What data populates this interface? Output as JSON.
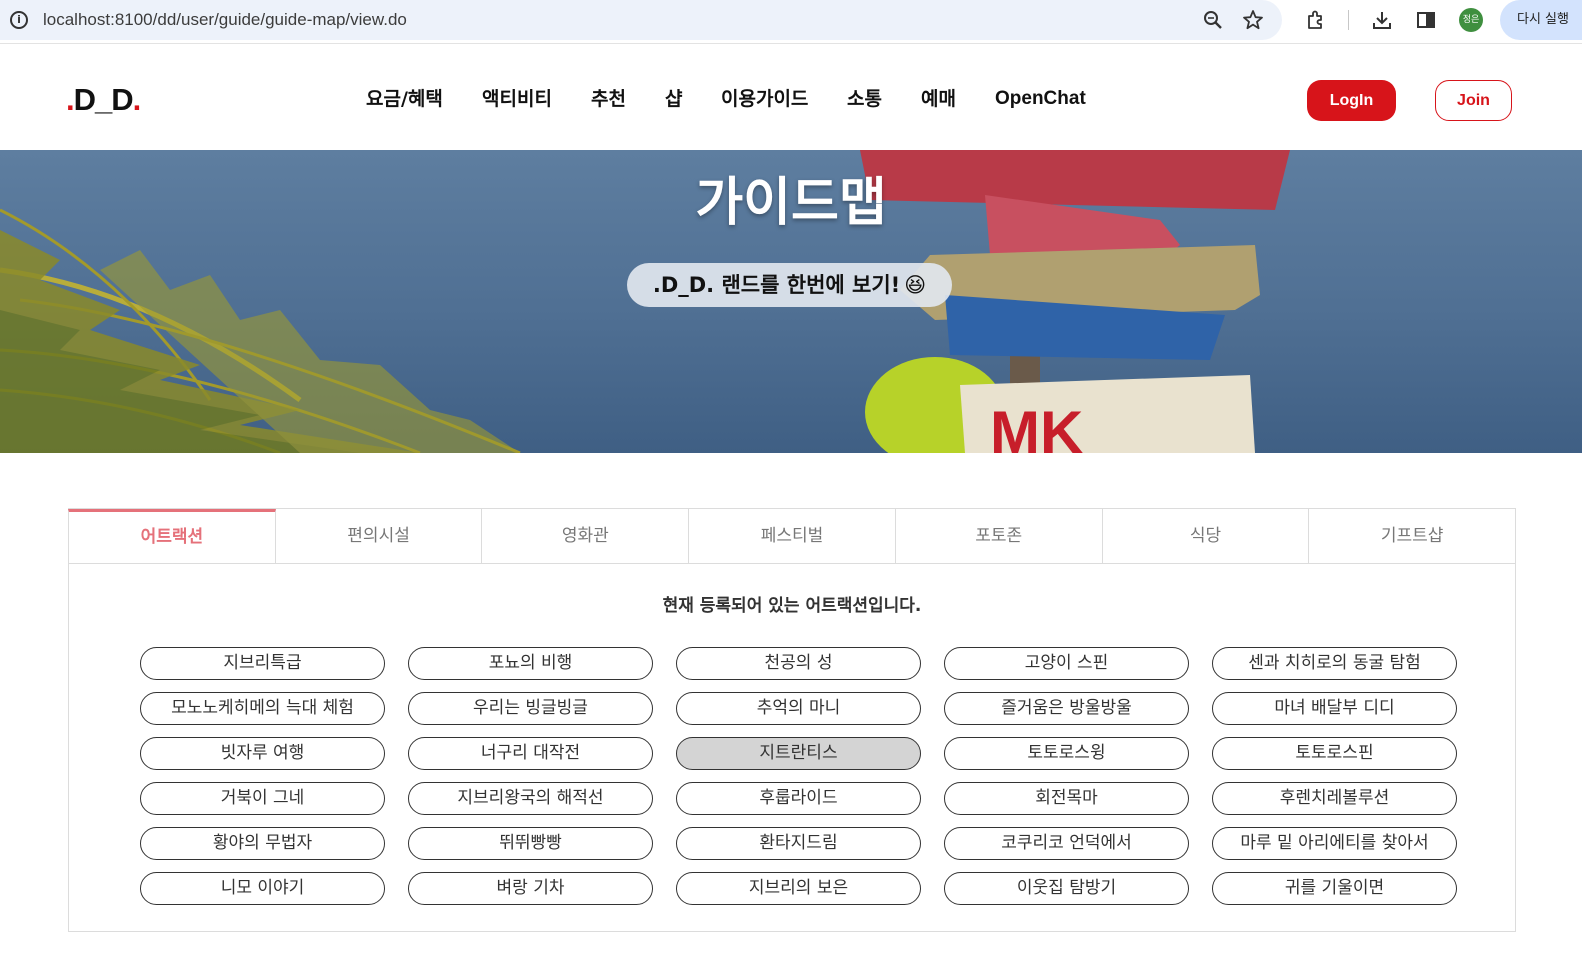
{
  "browser": {
    "url": "localhost:8100/dd/user/guide/guide-map/view.do",
    "profile_label": "정은",
    "relaunch_label": "다시 실행"
  },
  "header": {
    "logo_dot_left": ".",
    "logo_text": "D_D",
    "logo_dot_right": ".",
    "nav": [
      "요금/혜택",
      "액티비티",
      "추천",
      "샵",
      "이용가이드",
      "소통",
      "예매",
      "OpenChat"
    ],
    "login_label": "LogIn",
    "join_label": "Join"
  },
  "hero": {
    "title": "가이드맵",
    "subtitle": ".D_D. 랜드를 한번에 보기!",
    "emoji": "😆"
  },
  "tabs": [
    "어트랙션",
    "편의시설",
    "영화관",
    "페스티벌",
    "포토존",
    "식당",
    "기프트샵"
  ],
  "active_tab": "어트랙션",
  "panel": {
    "heading": "현재 등록되어 있는 어트랙션입니다.",
    "items": [
      "지브리특급",
      "포뇨의 비행",
      "천공의 성",
      "고양이 스핀",
      "센과 치히로의 동굴 탐험",
      "모노노케히메의 늑대 체험",
      "우리는 빙글빙글",
      "추억의 마니",
      "즐거움은 방울방울",
      "마녀 배달부 디디",
      "빗자루 여행",
      "너구리 대작전",
      "지트란티스",
      "토토로스윙",
      "토토로스핀",
      "거북이 그네",
      "지브리왕국의 해적선",
      "후룹라이드",
      "회전목마",
      "후렌치레볼루션",
      "황야의 무법자",
      "뛰뛰빵빵",
      "환타지드림",
      "코쿠리코 언덕에서",
      "마루 밑 아리에티를 찾아서",
      "니모 이야기",
      "벼랑 기차",
      "지브리의 보은",
      "이웃집 탐방기",
      "귀를 기울이면"
    ],
    "selected_item": "지트란티스"
  },
  "colors": {
    "brand_red": "#d7141a",
    "active_tab": "#e5717a",
    "selected_chip": "#d4d4d4"
  }
}
